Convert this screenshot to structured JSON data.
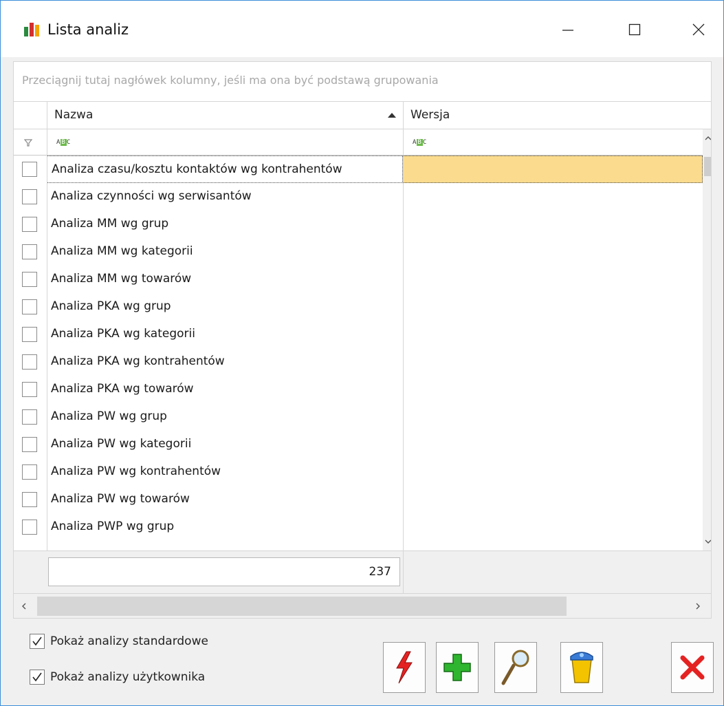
{
  "window": {
    "title": "Lista analiz"
  },
  "group_panel": {
    "hint": "Przeciągnij tutaj nagłówek kolumny, jeśli ma ona być podstawą grupowania"
  },
  "columns": [
    {
      "label": "Nazwa",
      "sorted": "ascending"
    },
    {
      "label": "Wersja"
    }
  ],
  "rows": [
    {
      "name": "Analiza czasu/kosztu kontaktów wg kontrahentów",
      "version": "",
      "selected": true
    },
    {
      "name": "Analiza czynności wg serwisantów",
      "version": ""
    },
    {
      "name": "Analiza MM wg grup",
      "version": ""
    },
    {
      "name": "Analiza MM wg kategorii",
      "version": ""
    },
    {
      "name": "Analiza MM wg towarów",
      "version": ""
    },
    {
      "name": "Analiza PKA wg grup",
      "version": ""
    },
    {
      "name": "Analiza PKA wg kategorii",
      "version": ""
    },
    {
      "name": "Analiza PKA wg kontrahentów",
      "version": ""
    },
    {
      "name": "Analiza PKA wg towarów",
      "version": ""
    },
    {
      "name": "Analiza PW wg grup",
      "version": ""
    },
    {
      "name": "Analiza PW wg kategorii",
      "version": ""
    },
    {
      "name": "Analiza PW wg kontrahentów",
      "version": ""
    },
    {
      "name": "Analiza PW wg towarów",
      "version": ""
    },
    {
      "name": "Analiza PWP wg grup",
      "version": ""
    }
  ],
  "summary": {
    "count": "237"
  },
  "options": {
    "show_standard": {
      "label": "Pokaż analizy standardowe",
      "checked": true
    },
    "show_user": {
      "label": "Pokaż analizy użytkownika",
      "checked": true
    }
  },
  "toolbar": {
    "icons": [
      "lightning-icon",
      "plus-icon",
      "magnifier-icon",
      "trash-bin-icon",
      "close-x-icon"
    ]
  },
  "colors": {
    "selection_fill": "#fbdc8e",
    "window_border": "#3c8ed8",
    "add_green": "#2fb52f",
    "delete_red": "#e52222"
  }
}
